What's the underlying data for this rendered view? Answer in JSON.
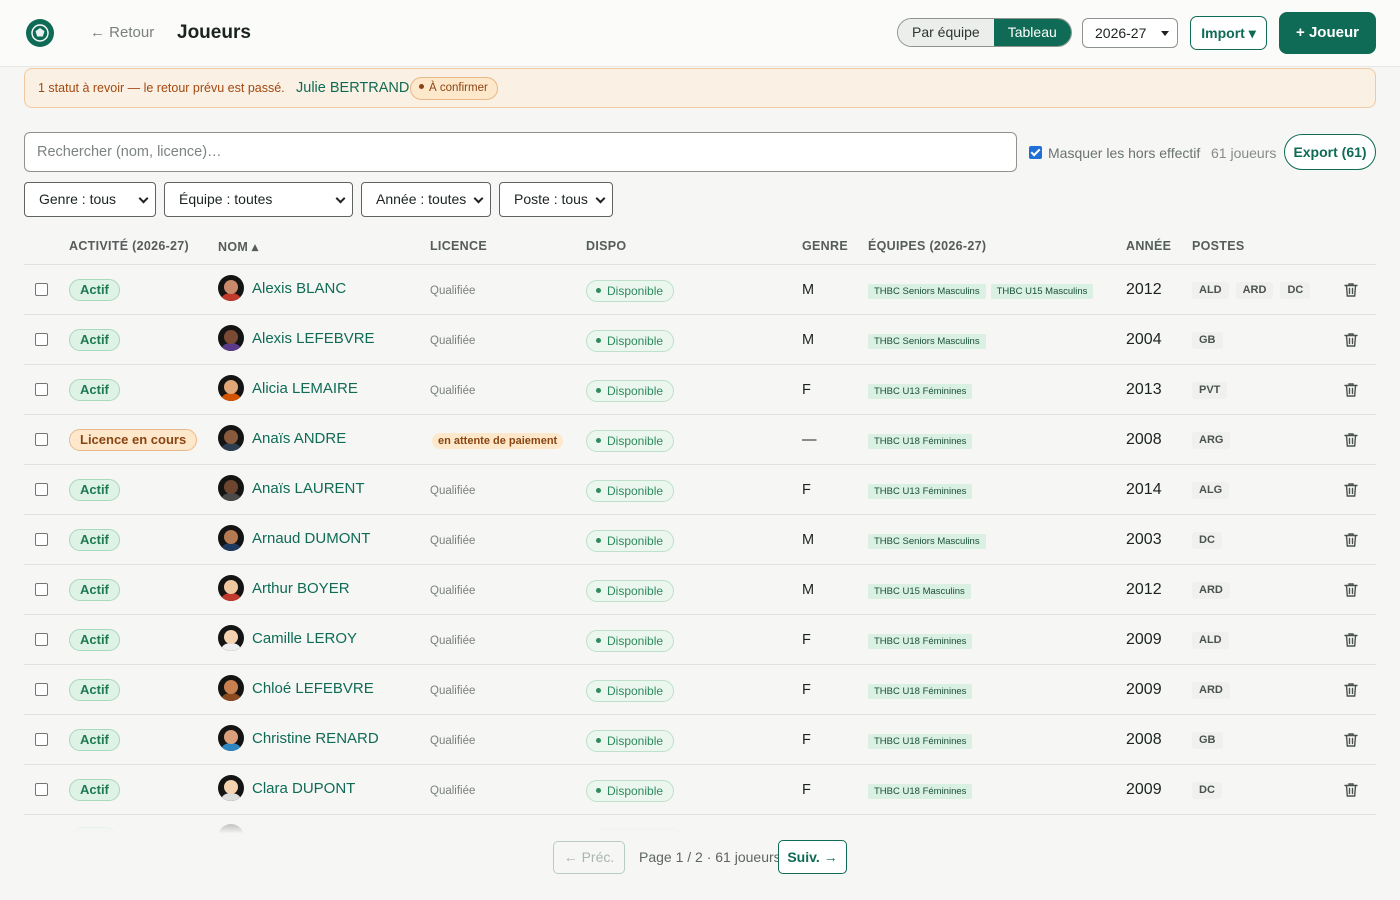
{
  "header": {
    "back_label": "← Retour",
    "title": "Joueurs",
    "view_options": [
      "Par équipe",
      "Tableau"
    ],
    "active_view": "Tableau",
    "season": "2026-27",
    "import_label": "Import ▾",
    "add_label": "+ Joueur"
  },
  "alert": {
    "message": "1 statut à revoir — le retour prévu est passé.",
    "player": "Julie BERTRAND",
    "badge": "À confirmer"
  },
  "toolbar": {
    "search_placeholder": "Rechercher (nom, licence)…",
    "hide_label": "Masquer les hors effectif",
    "hide_checked": true,
    "count_label": "61 joueurs",
    "export_label": "Export (61)"
  },
  "filters": {
    "genre": "Genre : tous",
    "equipe": "Équipe : toutes",
    "annee": "Année : toutes",
    "poste": "Poste : tous"
  },
  "columns": {
    "activite": "ACTIVITÉ (2026-27)",
    "nom": "NOM ▴",
    "licence": "LICENCE",
    "dispo": "DISPO",
    "genre": "GENRE",
    "equipes": "ÉQUIPES (2026-27)",
    "annee": "ANNÉE",
    "postes": "POSTES"
  },
  "colors": {
    "accent": "#0f6b55",
    "warning_bg": "#fde8cc",
    "success_bg": "#dff2e6"
  },
  "rows": [
    {
      "status": "Actif",
      "status_type": "actif",
      "name": "Alexis BLANC",
      "licence": "Qualifiée",
      "licence_pending": false,
      "dispo": "Disponible",
      "genre": "M",
      "teams": [
        "THBC Seniors Masculins",
        "THBC U15 Masculins"
      ],
      "year": "2012",
      "posts": [
        "ALD",
        "ARD",
        "DC"
      ],
      "skin": "#c98a6b",
      "shirt": "#c0392b"
    },
    {
      "status": "Actif",
      "status_type": "actif",
      "name": "Alexis LEFEBVRE",
      "licence": "Qualifiée",
      "licence_pending": false,
      "dispo": "Disponible",
      "genre": "M",
      "teams": [
        "THBC Seniors Masculins"
      ],
      "year": "2004",
      "posts": [
        "GB"
      ],
      "skin": "#7a4a32",
      "shirt": "#5b3a8a"
    },
    {
      "status": "Actif",
      "status_type": "actif",
      "name": "Alicia LEMAIRE",
      "licence": "Qualifiée",
      "licence_pending": false,
      "dispo": "Disponible",
      "genre": "F",
      "teams": [
        "THBC U13 Féminines"
      ],
      "year": "2013",
      "posts": [
        "PVT"
      ],
      "skin": "#e0a878",
      "shirt": "#d35400"
    },
    {
      "status": "Licence en cours",
      "status_type": "pending",
      "name": "Anaïs ANDRE",
      "licence": "en attente de paiement",
      "licence_pending": true,
      "dispo": "Disponible",
      "genre": "—",
      "teams": [
        "THBC U18 Féminines"
      ],
      "year": "2008",
      "posts": [
        "ARG"
      ],
      "skin": "#8a5a3c",
      "shirt": "#2c3e50"
    },
    {
      "status": "Actif",
      "status_type": "actif",
      "name": "Anaïs LAURENT",
      "licence": "Qualifiée",
      "licence_pending": false,
      "dispo": "Disponible",
      "genre": "F",
      "teams": [
        "THBC U13 Féminines"
      ],
      "year": "2014",
      "posts": [
        "ALG"
      ],
      "skin": "#6e4630",
      "shirt": "#4a4a4a"
    },
    {
      "status": "Actif",
      "status_type": "actif",
      "name": "Arnaud DUMONT",
      "licence": "Qualifiée",
      "licence_pending": false,
      "dispo": "Disponible",
      "genre": "M",
      "teams": [
        "THBC Seniors Masculins"
      ],
      "year": "2003",
      "posts": [
        "DC"
      ],
      "skin": "#b67a52",
      "shirt": "#1f3a5f"
    },
    {
      "status": "Actif",
      "status_type": "actif",
      "name": "Arthur BOYER",
      "licence": "Qualifiée",
      "licence_pending": false,
      "dispo": "Disponible",
      "genre": "M",
      "teams": [
        "THBC U15 Masculins"
      ],
      "year": "2012",
      "posts": [
        "ARD"
      ],
      "skin": "#f0c8a0",
      "shirt": "#c0392b"
    },
    {
      "status": "Actif",
      "status_type": "actif",
      "name": "Camille LEROY",
      "licence": "Qualifiée",
      "licence_pending": false,
      "dispo": "Disponible",
      "genre": "F",
      "teams": [
        "THBC U18 Féminines"
      ],
      "year": "2009",
      "posts": [
        "ALD"
      ],
      "skin": "#f3d2b0",
      "shirt": "#eeeeee"
    },
    {
      "status": "Actif",
      "status_type": "actif",
      "name": "Chloé LEFEBVRE",
      "licence": "Qualifiée",
      "licence_pending": false,
      "dispo": "Disponible",
      "genre": "F",
      "teams": [
        "THBC U18 Féminines"
      ],
      "year": "2009",
      "posts": [
        "ARD"
      ],
      "skin": "#c8804e",
      "shirt": "#8a4a20"
    },
    {
      "status": "Actif",
      "status_type": "actif",
      "name": "Christine RENARD",
      "licence": "Qualifiée",
      "licence_pending": false,
      "dispo": "Disponible",
      "genre": "F",
      "teams": [
        "THBC U18 Féminines"
      ],
      "year": "2008",
      "posts": [
        "GB"
      ],
      "skin": "#d9a07a",
      "shirt": "#2e86c1"
    },
    {
      "status": "Actif",
      "status_type": "actif",
      "name": "Clara DUPONT",
      "licence": "Qualifiée",
      "licence_pending": false,
      "dispo": "Disponible",
      "genre": "F",
      "teams": [
        "THBC U18 Féminines"
      ],
      "year": "2009",
      "posts": [
        "DC"
      ],
      "skin": "#f3d2b0",
      "shirt": "#dddddd"
    }
  ],
  "pagination": {
    "prev_label": "← Préc.",
    "info": "Page 1 / 2 · 61 joueurs",
    "next_label": "Suiv. →"
  }
}
